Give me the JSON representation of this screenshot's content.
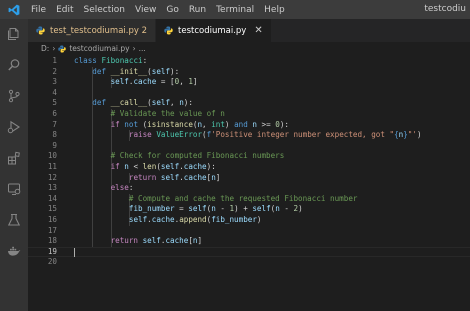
{
  "titlebar": {
    "menu": [
      "File",
      "Edit",
      "Selection",
      "View",
      "Go",
      "Run",
      "Terminal",
      "Help"
    ],
    "window_title": "testcodiu"
  },
  "activitybar": {
    "icons": [
      "explorer-icon",
      "search-icon",
      "source-control-icon",
      "run-debug-icon",
      "extensions-icon",
      "remote-explorer-icon",
      "testing-icon",
      "docker-icon"
    ]
  },
  "tabs": [
    {
      "label": "test_testcodiumai.py 2",
      "active": false
    },
    {
      "label": "testcodiumai.py",
      "active": true,
      "close": "✕"
    }
  ],
  "breadcrumb": {
    "root": "D:",
    "sep": "›",
    "file": "testcodiumai.py",
    "more": "..."
  },
  "editor": {
    "current_line": 19,
    "lines": [
      {
        "n": "1",
        "tokens": [
          [
            "kw",
            "class "
          ],
          [
            "cls",
            "Fibonacci"
          ],
          [
            "txt",
            ":"
          ]
        ]
      },
      {
        "n": "2",
        "tokens": [
          [
            "txt",
            "    "
          ],
          [
            "kw",
            "def "
          ],
          [
            "fn",
            "__init__"
          ],
          [
            "txt",
            "("
          ],
          [
            "var",
            "self"
          ],
          [
            "txt",
            "):"
          ]
        ]
      },
      {
        "n": "3",
        "tokens": [
          [
            "txt",
            "        "
          ],
          [
            "var",
            "self"
          ],
          [
            "txt",
            "."
          ],
          [
            "var",
            "cache"
          ],
          [
            "txt",
            " = ["
          ],
          [
            "num",
            "0"
          ],
          [
            "txt",
            ", "
          ],
          [
            "num",
            "1"
          ],
          [
            "txt",
            "]"
          ]
        ]
      },
      {
        "n": "4",
        "tokens": []
      },
      {
        "n": "5",
        "tokens": [
          [
            "txt",
            "    "
          ],
          [
            "kw",
            "def "
          ],
          [
            "fn",
            "__call__"
          ],
          [
            "txt",
            "("
          ],
          [
            "var",
            "self"
          ],
          [
            "txt",
            ", "
          ],
          [
            "var",
            "n"
          ],
          [
            "txt",
            "):"
          ]
        ]
      },
      {
        "n": "6",
        "tokens": [
          [
            "txt",
            "        "
          ],
          [
            "cmt",
            "# Validate the value of n"
          ]
        ]
      },
      {
        "n": "7",
        "tokens": [
          [
            "txt",
            "        "
          ],
          [
            "kw2",
            "if "
          ],
          [
            "kw",
            "not "
          ],
          [
            "txt",
            "("
          ],
          [
            "fn",
            "isinstance"
          ],
          [
            "txt",
            "("
          ],
          [
            "var",
            "n"
          ],
          [
            "txt",
            ", "
          ],
          [
            "cls",
            "int"
          ],
          [
            "txt",
            ") "
          ],
          [
            "kw",
            "and "
          ],
          [
            "var",
            "n"
          ],
          [
            "txt",
            " >= "
          ],
          [
            "num",
            "0"
          ],
          [
            "txt",
            "):"
          ]
        ]
      },
      {
        "n": "8",
        "tokens": [
          [
            "txt",
            "            "
          ],
          [
            "kw2",
            "raise "
          ],
          [
            "cls",
            "ValueError"
          ],
          [
            "txt",
            "("
          ],
          [
            "kw",
            "f"
          ],
          [
            "str",
            "'Positive integer number expected, got \""
          ],
          [
            "kw",
            "{"
          ],
          [
            "var",
            "n"
          ],
          [
            "kw",
            "}"
          ],
          [
            "str",
            "\"'"
          ],
          [
            "txt",
            ")"
          ]
        ]
      },
      {
        "n": "9",
        "tokens": []
      },
      {
        "n": "10",
        "tokens": [
          [
            "txt",
            "        "
          ],
          [
            "cmt",
            "# Check for computed Fibonacci numbers"
          ]
        ]
      },
      {
        "n": "11",
        "tokens": [
          [
            "txt",
            "        "
          ],
          [
            "kw2",
            "if "
          ],
          [
            "var",
            "n"
          ],
          [
            "txt",
            " < "
          ],
          [
            "fn",
            "len"
          ],
          [
            "txt",
            "("
          ],
          [
            "var",
            "self"
          ],
          [
            "txt",
            "."
          ],
          [
            "var",
            "cache"
          ],
          [
            "txt",
            "):"
          ]
        ]
      },
      {
        "n": "12",
        "tokens": [
          [
            "txt",
            "            "
          ],
          [
            "kw2",
            "return "
          ],
          [
            "var",
            "self"
          ],
          [
            "txt",
            "."
          ],
          [
            "var",
            "cache"
          ],
          [
            "txt",
            "["
          ],
          [
            "var",
            "n"
          ],
          [
            "txt",
            "]"
          ]
        ]
      },
      {
        "n": "13",
        "tokens": [
          [
            "txt",
            "        "
          ],
          [
            "kw2",
            "else"
          ],
          [
            "txt",
            ":"
          ]
        ]
      },
      {
        "n": "14",
        "tokens": [
          [
            "txt",
            "            "
          ],
          [
            "cmt",
            "# Compute and cache the requested Fibonacci number"
          ]
        ]
      },
      {
        "n": "15",
        "tokens": [
          [
            "txt",
            "            "
          ],
          [
            "var",
            "fib_number"
          ],
          [
            "txt",
            " = "
          ],
          [
            "var",
            "self"
          ],
          [
            "txt",
            "("
          ],
          [
            "var",
            "n"
          ],
          [
            "txt",
            " - "
          ],
          [
            "num",
            "1"
          ],
          [
            "txt",
            ") + "
          ],
          [
            "var",
            "self"
          ],
          [
            "txt",
            "("
          ],
          [
            "var",
            "n"
          ],
          [
            "txt",
            " - "
          ],
          [
            "num",
            "2"
          ],
          [
            "txt",
            ")"
          ]
        ]
      },
      {
        "n": "16",
        "tokens": [
          [
            "txt",
            "            "
          ],
          [
            "var",
            "self"
          ],
          [
            "txt",
            "."
          ],
          [
            "var",
            "cache"
          ],
          [
            "txt",
            "."
          ],
          [
            "fn",
            "append"
          ],
          [
            "txt",
            "("
          ],
          [
            "var",
            "fib_number"
          ],
          [
            "txt",
            ")"
          ]
        ]
      },
      {
        "n": "17",
        "tokens": []
      },
      {
        "n": "18",
        "tokens": [
          [
            "txt",
            "        "
          ],
          [
            "kw2",
            "return "
          ],
          [
            "var",
            "self"
          ],
          [
            "txt",
            "."
          ],
          [
            "var",
            "cache"
          ],
          [
            "txt",
            "["
          ],
          [
            "var",
            "n"
          ],
          [
            "txt",
            "]"
          ]
        ]
      },
      {
        "n": "19",
        "tokens": []
      },
      {
        "n": "20",
        "tokens": []
      }
    ]
  },
  "colors": {
    "accent_python": "#3572a5",
    "modified_tab": "#e2c08d"
  }
}
